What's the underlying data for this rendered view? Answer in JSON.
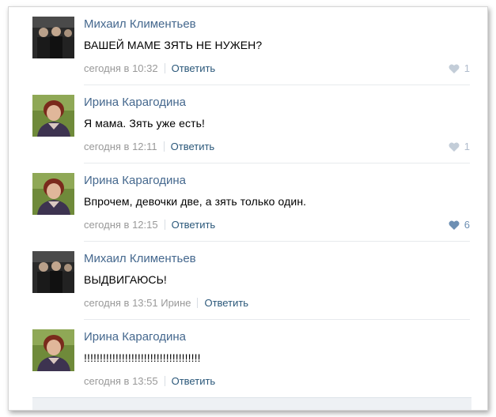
{
  "comments": [
    {
      "author": "Михаил Климентьев",
      "text": "ВАШЕЙ МАМЕ ЗЯТЬ НЕ НУЖЕН?",
      "time": "сегодня в 10:32",
      "recipient": "",
      "reply": "Ответить",
      "likes": "1",
      "avatar": "man-avatar",
      "liked": false
    },
    {
      "author": "Ирина Карагодина",
      "text": "Я мама. Зять уже есть!",
      "time": "сегодня в 12:11",
      "recipient": "",
      "reply": "Ответить",
      "likes": "1",
      "avatar": "woman-avatar",
      "liked": false
    },
    {
      "author": "Ирина Карагодина",
      "text": "Впрочем, девочки две, а зять только один.",
      "time": "сегодня в 12:15",
      "recipient": "",
      "reply": "Ответить",
      "likes": "6",
      "avatar": "woman-avatar",
      "liked": true
    },
    {
      "author": "Михаил Климентьев",
      "text": "ВЫДВИГАЮСЬ!",
      "time": "сегодня в 13:51",
      "recipient": "Ирине",
      "reply": "Ответить",
      "likes": "",
      "avatar": "man-avatar",
      "liked": false
    },
    {
      "author": "Ирина Карагодина",
      "text": "!!!!!!!!!!!!!!!!!!!!!!!!!!!!!!!!!!!!!",
      "time": "сегодня в 13:55",
      "recipient": "",
      "reply": "Ответить",
      "likes": "",
      "avatar": "woman-avatar",
      "liked": false
    }
  ],
  "colors": {
    "author": "#45688e",
    "reply": "#2b587a",
    "meta": "#999999",
    "heart_inactive": "#c3cdd8",
    "heart_active": "#6d8fb3"
  }
}
